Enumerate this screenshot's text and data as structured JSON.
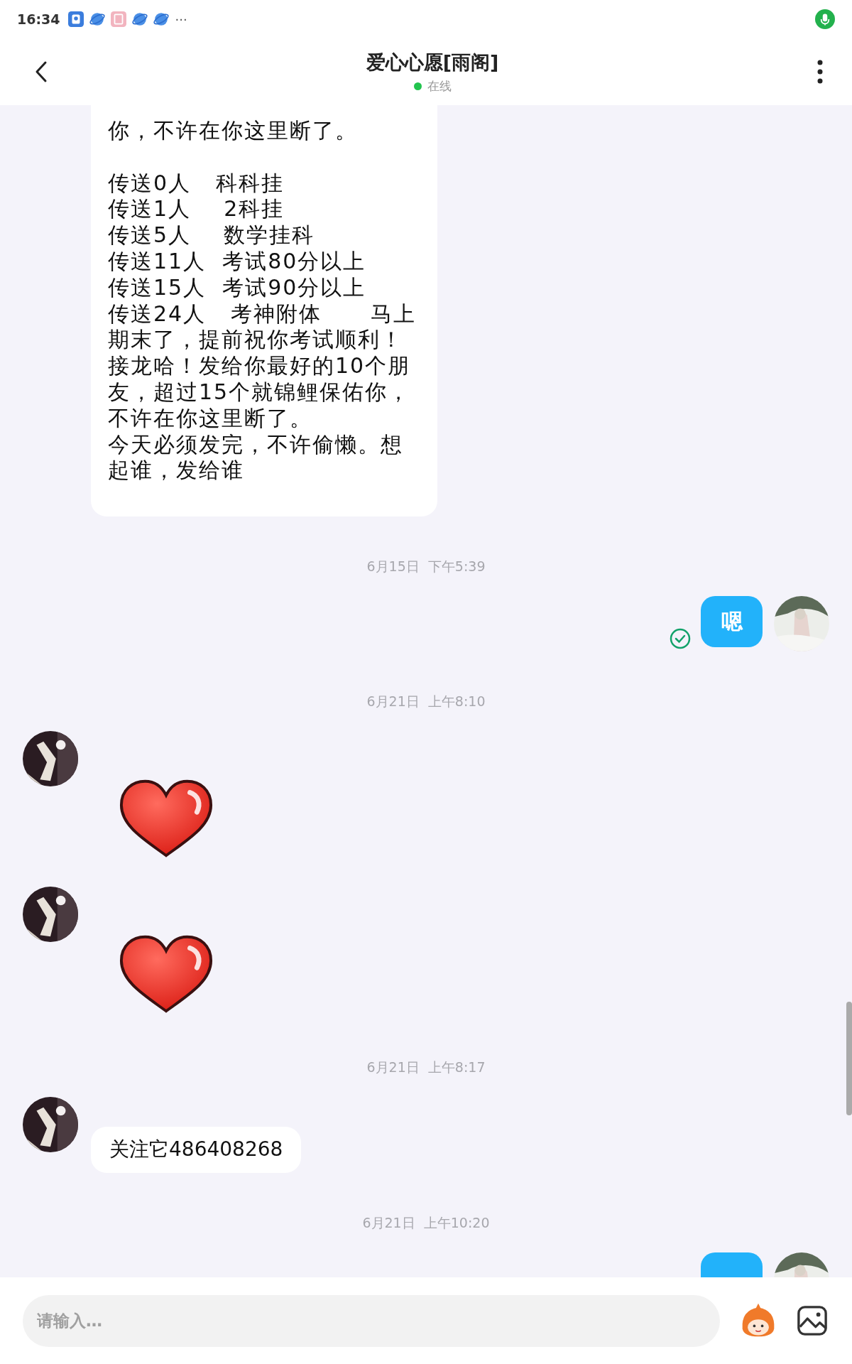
{
  "status_bar": {
    "time": "16:34",
    "more": "···"
  },
  "header": {
    "title": "爱心心愿[雨阁]",
    "presence": "在线",
    "online": true
  },
  "messages": [
    {
      "kind": "text",
      "outgoing": false,
      "cut_top": true,
      "groups": [
        [
          "你，不许在你这里断了。"
        ],
        [
          "传送0人   科科挂",
          "传送1人    2科挂",
          "传送5人    数学挂科",
          "传送11人  考试80分以上",
          "传送15人  考试90分以上",
          "传送24人   考神附体      马上期末了，提前祝你考试顺利！接龙哈！发给你最好的10个朋友，超过15个就锦鲤保佑你，不许在你这里断了。",
          "今天必须发完，不许偷懒。想起谁，发给谁"
        ]
      ]
    },
    {
      "kind": "timestamp",
      "text": "6月15日  下午5:39"
    },
    {
      "kind": "text",
      "outgoing": true,
      "text": "嗯",
      "read": true
    },
    {
      "kind": "timestamp",
      "text": "6月21日  上午8:10"
    },
    {
      "kind": "sticker",
      "outgoing": false
    },
    {
      "kind": "sticker",
      "outgoing": false
    },
    {
      "kind": "timestamp",
      "text": "6月21日  上午8:17"
    },
    {
      "kind": "text",
      "outgoing": false,
      "text": "关注它486408268"
    },
    {
      "kind": "timestamp",
      "text": "6月21日  上午10:20"
    },
    {
      "kind": "partial",
      "outgoing": true
    }
  ],
  "input": {
    "placeholder": "请输入…"
  }
}
